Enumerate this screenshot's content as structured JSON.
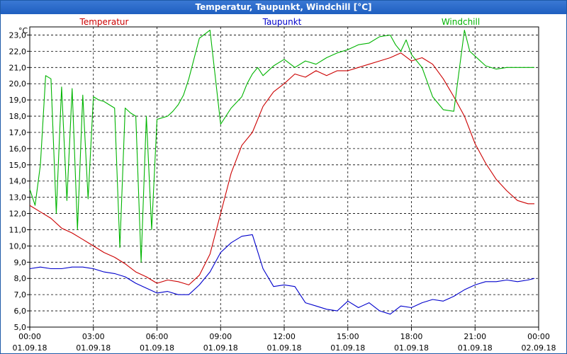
{
  "title": "Temperatur, Taupunkt, Windchill [°C]",
  "chart_data": {
    "type": "line",
    "unit_label": "°C",
    "ylim": [
      5.0,
      23.5
    ],
    "yticks": [
      "5,0",
      "6,0",
      "7,0",
      "8,0",
      "9,0",
      "10,0",
      "11,0",
      "12,0",
      "13,0",
      "14,0",
      "15,0",
      "16,0",
      "17,0",
      "18,0",
      "19,0",
      "20,0",
      "21,0",
      "22,0",
      "23,0"
    ],
    "xlim_hours": [
      0,
      24
    ],
    "xticks": [
      {
        "time": "00:00",
        "date": "01.09.18"
      },
      {
        "time": "03:00",
        "date": "01.09.18"
      },
      {
        "time": "06:00",
        "date": "01.09.18"
      },
      {
        "time": "09:00",
        "date": "01.09.18"
      },
      {
        "time": "12:00",
        "date": "01.09.18"
      },
      {
        "time": "15:00",
        "date": "01.09.18"
      },
      {
        "time": "18:00",
        "date": "01.09.18"
      },
      {
        "time": "21:00",
        "date": "01.09.18"
      },
      {
        "time": "00:00",
        "date": "02.09.18"
      }
    ],
    "grid": true,
    "legend_position": "top",
    "series": [
      {
        "name": "Temperatur",
        "color": "#cc0000",
        "x": [
          0,
          0.5,
          1,
          1.5,
          2,
          2.5,
          3,
          3.5,
          4,
          4.5,
          5,
          5.5,
          6,
          6.5,
          7,
          7.5,
          8,
          8.5,
          9,
          9.5,
          10,
          10.5,
          11,
          11.5,
          12,
          12.5,
          13,
          13.5,
          14,
          14.5,
          15,
          15.5,
          16,
          16.5,
          17,
          17.5,
          18,
          18.5,
          19,
          19.5,
          20,
          20.5,
          21,
          21.5,
          22,
          22.5,
          23,
          23.5,
          23.8
        ],
        "y": [
          12.5,
          12.1,
          11.7,
          11.1,
          10.8,
          10.4,
          10.0,
          9.6,
          9.3,
          8.9,
          8.4,
          8.1,
          7.7,
          7.9,
          7.8,
          7.6,
          8.2,
          9.5,
          12.0,
          14.5,
          16.2,
          17.0,
          18.6,
          19.5,
          20.0,
          20.6,
          20.4,
          20.8,
          20.5,
          20.8,
          20.8,
          21.0,
          21.2,
          21.4,
          21.6,
          21.9,
          21.4,
          21.6,
          21.2,
          20.3,
          19.2,
          18.0,
          16.3,
          15.1,
          14.1,
          13.4,
          12.8,
          12.6,
          12.6
        ]
      },
      {
        "name": "Taupunkt",
        "color": "#0000cc",
        "x": [
          0,
          0.5,
          1,
          1.5,
          2,
          2.5,
          3,
          3.5,
          4,
          4.5,
          5,
          5.5,
          6,
          6.5,
          7,
          7.5,
          8,
          8.5,
          9,
          9.5,
          10,
          10.5,
          11,
          11.5,
          12,
          12.5,
          13,
          13.5,
          14,
          14.5,
          15,
          15.5,
          16,
          16.5,
          17,
          17.5,
          18,
          18.5,
          19,
          19.5,
          20,
          20.5,
          21,
          21.5,
          22,
          22.5,
          23,
          23.5,
          23.8
        ],
        "y": [
          8.6,
          8.7,
          8.6,
          8.6,
          8.7,
          8.7,
          8.6,
          8.4,
          8.3,
          8.1,
          7.7,
          7.4,
          7.1,
          7.2,
          7.0,
          7.0,
          7.6,
          8.4,
          9.6,
          10.2,
          10.6,
          10.7,
          8.6,
          7.5,
          7.6,
          7.5,
          6.5,
          6.3,
          6.1,
          6.0,
          6.6,
          6.2,
          6.5,
          6.0,
          5.8,
          6.3,
          6.2,
          6.5,
          6.7,
          6.6,
          6.9,
          7.3,
          7.6,
          7.8,
          7.8,
          7.9,
          7.8,
          7.9,
          8.0
        ]
      },
      {
        "name": "Windchill",
        "color": "#00b400",
        "x": [
          0,
          0.25,
          0.5,
          0.75,
          1,
          1.25,
          1.5,
          1.75,
          2,
          2.25,
          2.5,
          2.75,
          3,
          3.25,
          3.5,
          3.75,
          4,
          4.25,
          4.5,
          4.75,
          5,
          5.25,
          5.5,
          5.75,
          6,
          6.25,
          6.5,
          6.75,
          7,
          7.25,
          7.5,
          8,
          8.5,
          9,
          9.5,
          10,
          10.25,
          10.5,
          10.75,
          11,
          11.5,
          12,
          12.5,
          13,
          13.5,
          14,
          14.5,
          15,
          15.5,
          16,
          16.5,
          17,
          17.25,
          17.5,
          17.75,
          18,
          18.5,
          19,
          19.5,
          20,
          20.5,
          20.75,
          21,
          21.5,
          22,
          22.5,
          23,
          23.5,
          23.8
        ],
        "y": [
          13.5,
          12.5,
          15.0,
          20.5,
          20.3,
          12.0,
          19.8,
          12.8,
          19.7,
          11.0,
          19.3,
          12.9,
          19.2,
          19.0,
          18.9,
          18.7,
          18.5,
          9.9,
          18.5,
          18.2,
          18.0,
          9.0,
          18.0,
          11.0,
          17.8,
          17.9,
          18.0,
          18.3,
          18.7,
          19.3,
          20.3,
          22.8,
          23.3,
          17.5,
          18.5,
          19.2,
          20.0,
          20.6,
          21.0,
          20.5,
          21.1,
          21.5,
          21.0,
          21.4,
          21.2,
          21.6,
          21.9,
          22.1,
          22.4,
          22.5,
          22.9,
          23.0,
          22.4,
          22.0,
          22.7,
          21.8,
          21.0,
          19.2,
          18.4,
          18.3,
          23.3,
          22.0,
          21.7,
          21.1,
          20.9,
          21.0,
          21.0,
          21.0,
          21.0
        ]
      }
    ]
  }
}
